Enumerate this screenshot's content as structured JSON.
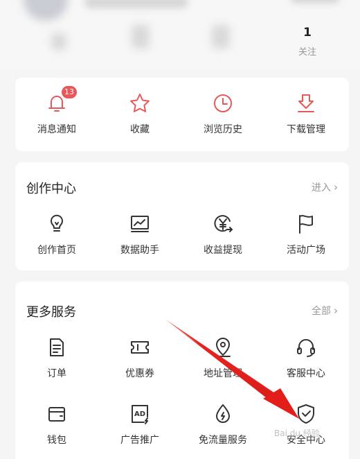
{
  "profile": {
    "follow_count": "1",
    "follow_label": "关注"
  },
  "quick_actions": [
    {
      "label": "消息通知",
      "icon": "bell-icon",
      "badge": "13"
    },
    {
      "label": "收藏",
      "icon": "star-icon"
    },
    {
      "label": "浏览历史",
      "icon": "clock-icon"
    },
    {
      "label": "下载管理",
      "icon": "download-icon"
    }
  ],
  "creation_center": {
    "title": "创作中心",
    "link": "进入",
    "items": [
      {
        "label": "创作首页",
        "icon": "lightbulb-icon"
      },
      {
        "label": "数据助手",
        "icon": "chart-monitor-icon"
      },
      {
        "label": "收益提现",
        "icon": "yen-withdraw-icon"
      },
      {
        "label": "活动广场",
        "icon": "flag-icon"
      }
    ]
  },
  "more_services": {
    "title": "更多服务",
    "link": "全部",
    "items": [
      {
        "label": "订单",
        "icon": "order-doc-icon"
      },
      {
        "label": "优惠券",
        "icon": "coupon-icon"
      },
      {
        "label": "地址管理",
        "icon": "location-pin-icon"
      },
      {
        "label": "客服中心",
        "icon": "headset-icon"
      },
      {
        "label": "钱包",
        "icon": "wallet-icon"
      },
      {
        "label": "广告推广",
        "icon": "ad-icon"
      },
      {
        "label": "免流量服务",
        "icon": "drop-icon"
      },
      {
        "label": "安全中心",
        "icon": "shield-check-icon"
      }
    ]
  },
  "colors": {
    "accent": "#e95858",
    "annotation_arrow": "#e8231f"
  }
}
